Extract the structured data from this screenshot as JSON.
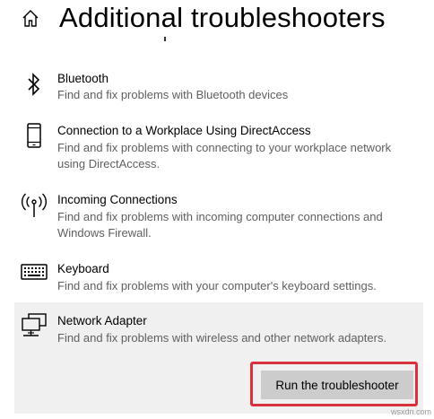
{
  "header": {
    "title": "Additional troubleshooters",
    "home_icon": "home-icon"
  },
  "troubleshooters": [
    {
      "icon": "bluetooth-icon",
      "name": "Bluetooth",
      "description": "Find and fix problems with Bluetooth devices"
    },
    {
      "icon": "phone-device-icon",
      "name": "Connection to a Workplace Using DirectAccess",
      "description": "Find and fix problems with connecting to your workplace network using DirectAccess."
    },
    {
      "icon": "antenna-icon",
      "name": "Incoming Connections",
      "description": "Find and fix problems with incoming computer connections and Windows Firewall."
    },
    {
      "icon": "keyboard-icon",
      "name": "Keyboard",
      "description": "Find and fix problems with your computer's keyboard settings."
    },
    {
      "icon": "network-adapter-icon",
      "name": "Network Adapter",
      "description": "Find and fix problems with wireless and other network adapters.",
      "selected": true
    }
  ],
  "actions": {
    "run_label": "Run the troubleshooter"
  },
  "colors": {
    "highlight_border": "#d9323f",
    "button_bg": "#cccccc",
    "selected_bg": "#f0f0f0"
  },
  "watermark": "wsxdn.com"
}
